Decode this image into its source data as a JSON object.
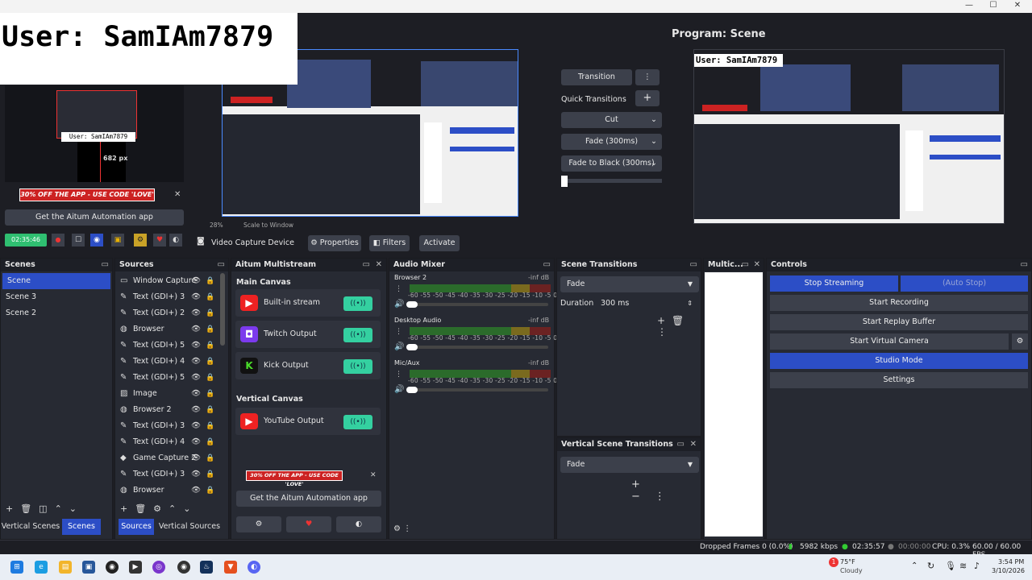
{
  "overlay": {
    "text": "User:  SamIAm7879"
  },
  "preview": {
    "zoom": "28%",
    "scale_label": "Scale to Window",
    "mini_user": "User: SamIAm7879",
    "px_label": "682 px"
  },
  "program": {
    "title": "Program: Scene",
    "user_text": "User:  SamIAm7879"
  },
  "transitions_block": {
    "transition": "Transition",
    "quick": "Quick Transitions",
    "items": [
      "Cut",
      "Fade (300ms)",
      "Fade to Black (300ms)"
    ]
  },
  "promo": {
    "text": "30% OFF THE APP - USE CODE 'LOVE'",
    "link": "Get the Aitum Automation app"
  },
  "rec_time": "02:35:46",
  "source_toolbar": {
    "device": "Video Capture Device",
    "properties": "Properties",
    "filters": "Filters",
    "activate": "Activate"
  },
  "scenes": {
    "title": "Scenes",
    "items": [
      "Scene",
      "Scene 3",
      "Scene 2"
    ],
    "tabs": [
      "Vertical Scenes",
      "Scenes"
    ]
  },
  "sources": {
    "title": "Sources",
    "items": [
      "Window Capture",
      "Text (GDI+) 3",
      "Text (GDI+) 2",
      "Browser",
      "Text (GDI+) 5",
      "Text (GDI+) 4",
      "Text (GDI+) 5",
      "Image",
      "Browser 2",
      "Text (GDI+) 3",
      "Text (GDI+) 4",
      "Game Capture 2",
      "Text (GDI+) 3",
      "Browser"
    ],
    "tabs": [
      "Sources",
      "Vertical Sources"
    ]
  },
  "multistream": {
    "title": "Aitum Multistream",
    "main": "Main Canvas",
    "vertical": "Vertical Canvas",
    "outputs": [
      "Built-in stream",
      "Twitch Output",
      "Kick Output"
    ],
    "vertical_outputs": [
      "YouTube Output"
    ]
  },
  "mixer": {
    "title": "Audio Mixer",
    "channels": [
      {
        "name": "Browser 2",
        "level": "-inf dB"
      },
      {
        "name": "Desktop Audio",
        "level": "-inf dB"
      },
      {
        "name": "Mic/Aux",
        "level": "-inf dB"
      }
    ],
    "ticks": "-60 -55 -50 -45 -40 -35 -30 -25 -20 -15 -10 -5 0"
  },
  "scene_transitions": {
    "title": "Scene Transitions",
    "value": "Fade",
    "duration_label": "Duration",
    "duration": "300 ms"
  },
  "vertical_transitions": {
    "title": "Vertical Scene Transitions",
    "value": "Fade"
  },
  "multiview": {
    "title": "Multic..."
  },
  "controls": {
    "title": "Controls",
    "stop": "Stop Streaming",
    "auto_stop": "(Auto Stop)",
    "record": "Start Recording",
    "replay": "Start Replay Buffer",
    "vcam": "Start Virtual Camera",
    "studio": "Studio Mode",
    "settings": "Settings"
  },
  "status": {
    "dropped": "Dropped Frames 0 (0.0%)",
    "kbps": "5982 kbps",
    "stream_time": "02:35:57",
    "rec_time": "00:00:00",
    "cpu": "CPU: 0.3%",
    "fps": "60.00 / 60.00 FPS"
  },
  "taskbar": {
    "temp": "75°F",
    "weather": "Cloudy",
    "time": "3:54 PM",
    "date": "3/10/2026",
    "badge": "1"
  },
  "colors": {
    "accent": "#2c4ec6",
    "toggle": "#34d0a0",
    "promo": "#c22222"
  }
}
